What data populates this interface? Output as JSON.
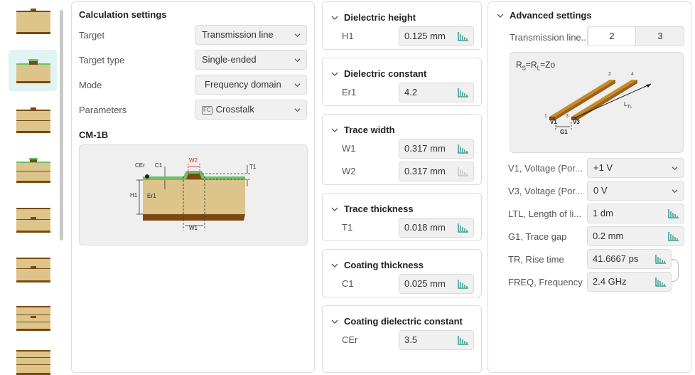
{
  "calc": {
    "title": "Calculation settings",
    "rows": [
      {
        "label": "Target",
        "value": "Transmission line"
      },
      {
        "label": "Target type",
        "value": "Single-ended"
      },
      {
        "label": "Mode",
        "value": "Frequency domain"
      },
      {
        "label": "Parameters",
        "value": "Crosstalk",
        "badge": "FC"
      }
    ],
    "model": "CM-1B",
    "diagram": {
      "cer": "CEr",
      "c1": "C1",
      "w2": "W2",
      "t1": "T1",
      "h1": "H1",
      "er1": "Er1",
      "w1": "W1"
    }
  },
  "sections": [
    {
      "title": "Dielectric height",
      "fields": [
        {
          "label": "H1",
          "value": "0.125 mm"
        }
      ]
    },
    {
      "title": "Dielectric constant",
      "fields": [
        {
          "label": "Er1",
          "value": "4.2"
        }
      ]
    },
    {
      "title": "Trace width",
      "fields": [
        {
          "label": "W1",
          "value": "0.317 mm"
        },
        {
          "label": "W2",
          "value": "0.317 mm"
        }
      ]
    },
    {
      "title": "Trace thickness",
      "fields": [
        {
          "label": "T1",
          "value": "0.018 mm"
        }
      ]
    },
    {
      "title": "Coating thickness",
      "fields": [
        {
          "label": "C1",
          "value": "0.025 mm"
        }
      ]
    },
    {
      "title": "Coating dielectric constant",
      "fields": [
        {
          "label": "CEr",
          "value": "3.5"
        }
      ]
    }
  ],
  "advanced": {
    "title": "Advanced settings",
    "lines_label": "Transmission line...",
    "lines_options": [
      "2",
      "3"
    ],
    "lines_selected": "2",
    "diagram": {
      "formula": "R",
      "formula_s": "S",
      "formula_eq": "=R",
      "formula_l": "L",
      "formula_z": "=Zo",
      "n1": "1",
      "n2": "2",
      "n3": "3",
      "n4": "4",
      "v1": "V1",
      "v3": "V3",
      "g1": "G1",
      "ltl": "L",
      "ltl_sub": "TL"
    },
    "rows": [
      {
        "label": "V1, Voltage (Por...",
        "value": "+1 V"
      },
      {
        "label": "V3, Voltage (Por...",
        "value": "0 V"
      },
      {
        "label": "LTL, Length of li...",
        "value": "1 dm"
      },
      {
        "label": "G1, Trace gap",
        "value": "0.2 mm"
      },
      {
        "label": "TR, Rise time",
        "value": "41.6667 ps"
      },
      {
        "label": "FREQ, Frequency",
        "value": "2.4 GHz"
      }
    ]
  },
  "colors": {
    "accent": "#22a996",
    "copper": "#7a4a10",
    "dielectric": "#dcc48b",
    "mask": "#6cc06a"
  }
}
